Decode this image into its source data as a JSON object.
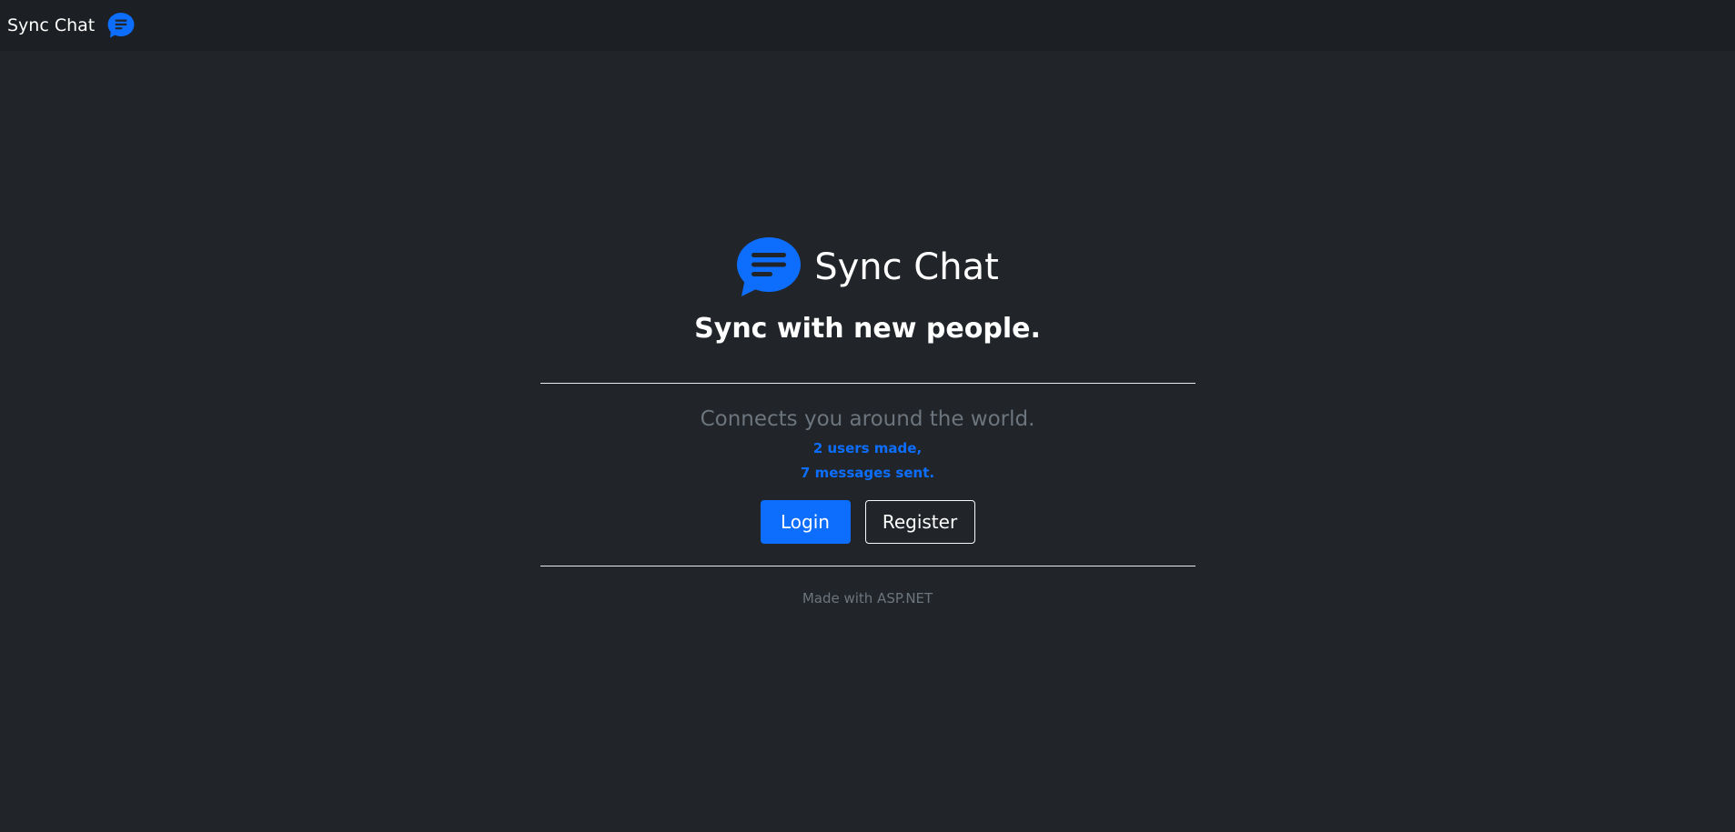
{
  "navbar": {
    "brand_label": "Sync Chat",
    "brand_icon": "chat-bubble-icon"
  },
  "hero": {
    "icon": "chat-bubble-icon",
    "title": "Sync Chat",
    "tagline": "Sync with new people."
  },
  "info": {
    "subtitle": "Connects you around the world.",
    "users_stat": "2 users made,",
    "messages_stat": "7 messages sent."
  },
  "actions": {
    "login_label": "Login",
    "register_label": "Register"
  },
  "footer": {
    "note": "Made with ASP.NET"
  },
  "colors": {
    "background": "#212529",
    "navbar": "#1c1f23",
    "accent": "#0d6efd",
    "muted": "#6c757d"
  }
}
